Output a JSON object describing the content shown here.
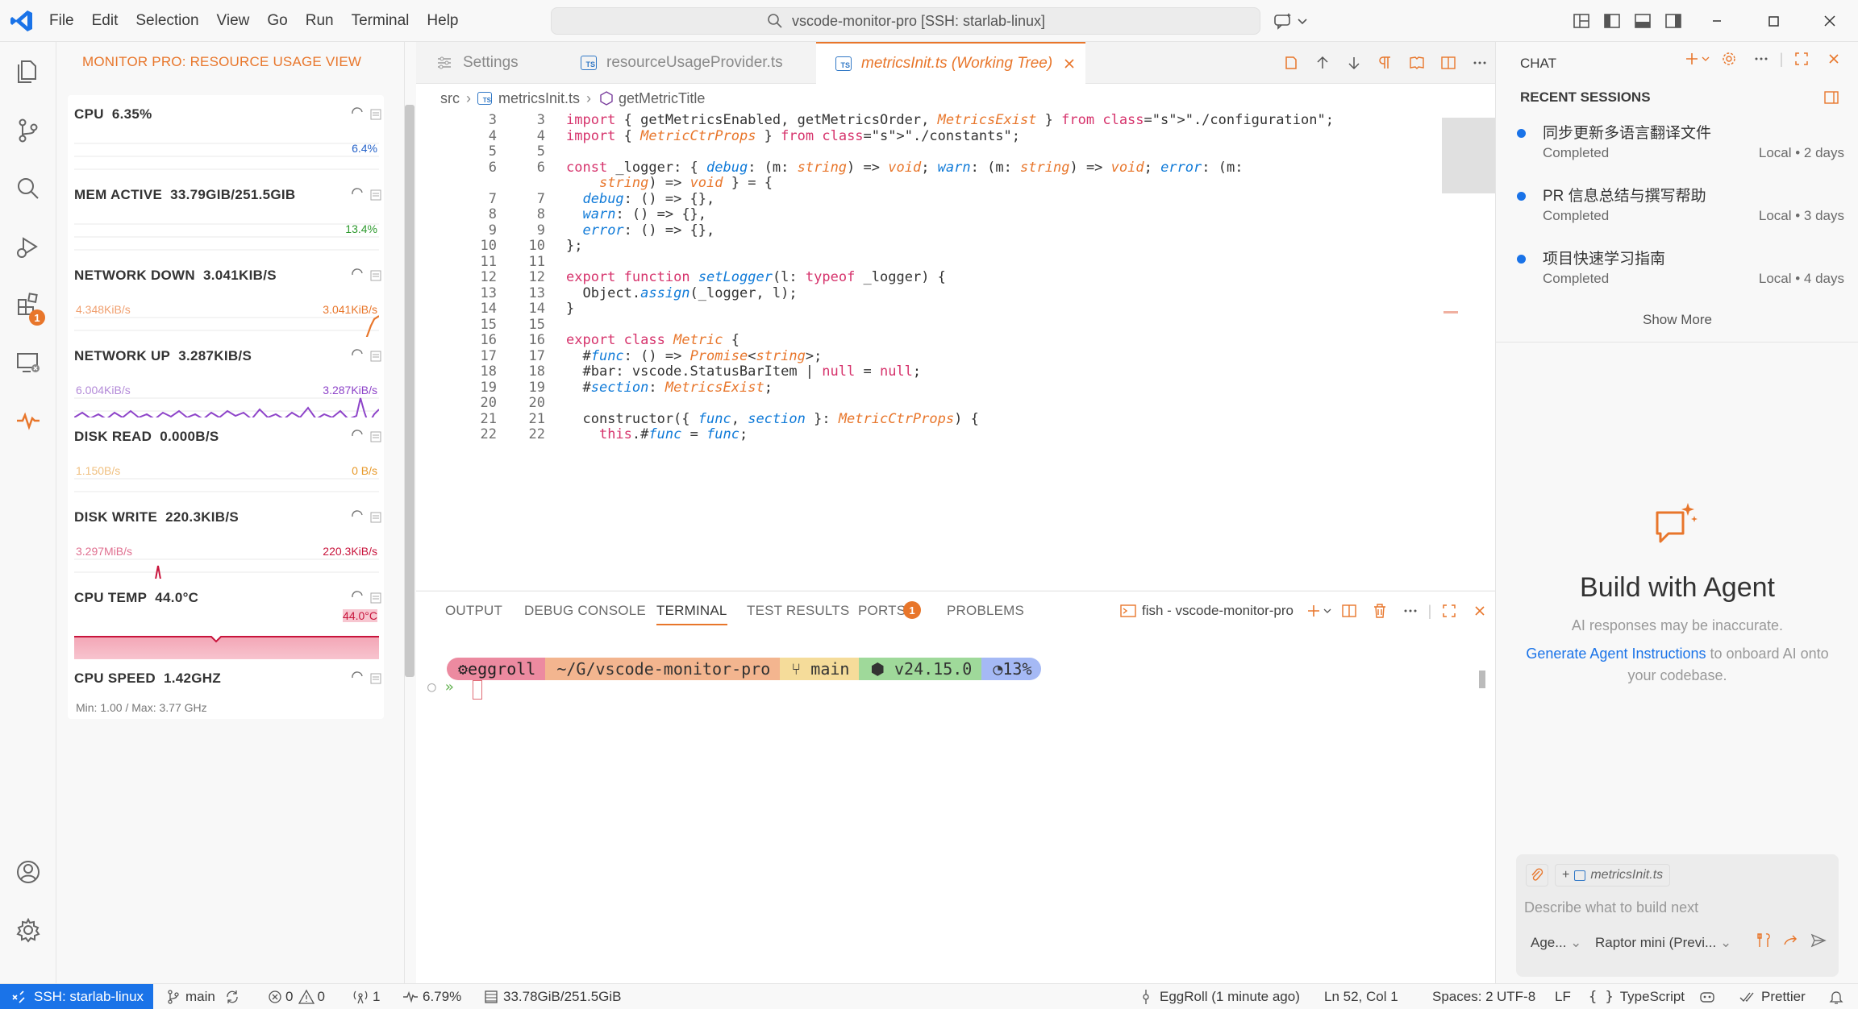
{
  "titlebar": {
    "menu": [
      "File",
      "Edit",
      "Selection",
      "View",
      "Go",
      "Run",
      "Terminal",
      "Help"
    ],
    "command_center": "vscode-monitor-pro [SSH: starlab-linux]"
  },
  "activitybar": {
    "extensions_badge": "1"
  },
  "sidebar": {
    "title": "MONITOR PRO: RESOURCE USAGE VIEW",
    "cards": [
      {
        "label": "CPU",
        "value": "6.35%",
        "left_label": "",
        "right_label": "6.4%",
        "color": "#2563c9"
      },
      {
        "label": "MEM ACTIVE",
        "value": "33.79GIB/251.5GIB",
        "left_label": "",
        "right_label": "13.4%",
        "color": "#2e9a2e"
      },
      {
        "label": "NETWORK DOWN",
        "value": "3.041KIB/S",
        "left_label": "4.348KiB/s",
        "right_label": "3.041KiB/s",
        "color": "#e8762b"
      },
      {
        "label": "NETWORK UP",
        "value": "3.287KIB/S",
        "left_label": "6.004KiB/s",
        "right_label": "3.287KiB/s",
        "color": "#8e44c9"
      },
      {
        "label": "DISK READ",
        "value": "0.000B/S",
        "left_label": "1.150B/s",
        "right_label": "0 B/s",
        "color": "#e89a2b"
      },
      {
        "label": "DISK WRITE",
        "value": "220.3KIB/S",
        "left_label": "3.297MiB/s",
        "right_label": "220.3KiB/s",
        "color": "#c8143c"
      },
      {
        "label": "CPU TEMP",
        "value": "44.0°C",
        "left_label": "",
        "right_label": "44.0°C",
        "color": "#c8143c"
      },
      {
        "label": "CPU SPEED",
        "value": "1.42GHZ",
        "left_label": "Min: 1.00 / Max: 3.77 GHz",
        "right_label": "",
        "color": "#888"
      }
    ]
  },
  "editor": {
    "tabs": [
      {
        "label": "Settings"
      },
      {
        "label": "resourceUsageProvider.ts"
      },
      {
        "label": "metricsInit.ts (Working Tree)"
      }
    ],
    "breadcrumb": [
      "src",
      "metricsInit.ts",
      "getMetricTitle"
    ],
    "line_numbers_left": [
      "3",
      "4",
      "5",
      "6",
      "",
      "7",
      "8",
      "9",
      "10",
      "11",
      "12",
      "13",
      "14",
      "15",
      "16",
      "17",
      "18",
      "19",
      "20",
      "21",
      "22"
    ],
    "line_numbers_right": [
      "3",
      "4",
      "5",
      "6",
      "",
      "7",
      "8",
      "9",
      "10",
      "11",
      "12",
      "13",
      "14",
      "15",
      "16",
      "17",
      "18",
      "19",
      "20",
      "21",
      "22"
    ],
    "code_text": [
      "import { getMetricsEnabled, getMetricsOrder, MetricsExist } from \"./configuration\";",
      "import { MetricCtrProps } from \"./constants\";",
      "",
      "const _logger: { debug: (m: string) => void; warn: (m: string) => void; error: (m:",
      "    string) => void } = {",
      "  debug: () => {},",
      "  warn: () => {},",
      "  error: () => {},",
      "};",
      "",
      "export function setLogger(l: typeof _logger) {",
      "  Object.assign(_logger, l);",
      "}",
      "",
      "export class Metric {",
      "  #func: () => Promise<string>;",
      "  #bar: vscode.StatusBarItem | null = null;",
      "  #section: MetricsExist;",
      "",
      "  constructor({ func, section }: MetricCtrProps) {",
      "    this.#func = func;"
    ]
  },
  "panel": {
    "tabs": [
      "OUTPUT",
      "DEBUG CONSOLE",
      "TERMINAL",
      "TEST RESULTS",
      "PORTS",
      "PROBLEMS"
    ],
    "ports_badge": "1",
    "terminal_name": "fish - vscode-monitor-pro",
    "prompt": {
      "user": "eggroll",
      "path": "~/G/vscode-monitor-pro",
      "branch": "main",
      "node": "v24.15.0",
      "battery": "13%"
    },
    "prompt_line": "»"
  },
  "chat": {
    "title": "CHAT",
    "recent_title": "RECENT SESSIONS",
    "sessions": [
      {
        "title": "同步更新多语言翻译文件",
        "status": "Completed",
        "where": "Local • 2 days"
      },
      {
        "title": "PR 信息总结与撰写帮助",
        "status": "Completed",
        "where": "Local • 3 days"
      },
      {
        "title": "项目快速学习指南",
        "status": "Completed",
        "where": "Local • 4 days"
      }
    ],
    "show_more": "Show More",
    "agent_title": "Build with Agent",
    "agent_subtitle": "AI responses may be inaccurate.",
    "agent_link": "Generate Agent Instructions",
    "agent_link_rest": " to onboard AI onto your codebase.",
    "input_file": "metricsInit.ts",
    "input_placeholder": "Describe what to build next",
    "mode": "Age...",
    "model": "Raptor mini (Previ..."
  },
  "statusbar": {
    "remote": "SSH: starlab-linux",
    "branch": "main",
    "errors": "0",
    "warnings": "0",
    "ports": "1",
    "cpu": "6.79%",
    "mem": "33.78GiB/251.5GiB",
    "blame": "EggRoll (1 minute ago)",
    "position": "Ln 52, Col 1",
    "spaces": "Spaces: 2",
    "encoding": "UTF-8",
    "eol": "LF",
    "language": "TypeScript",
    "formatter": "Prettier"
  }
}
